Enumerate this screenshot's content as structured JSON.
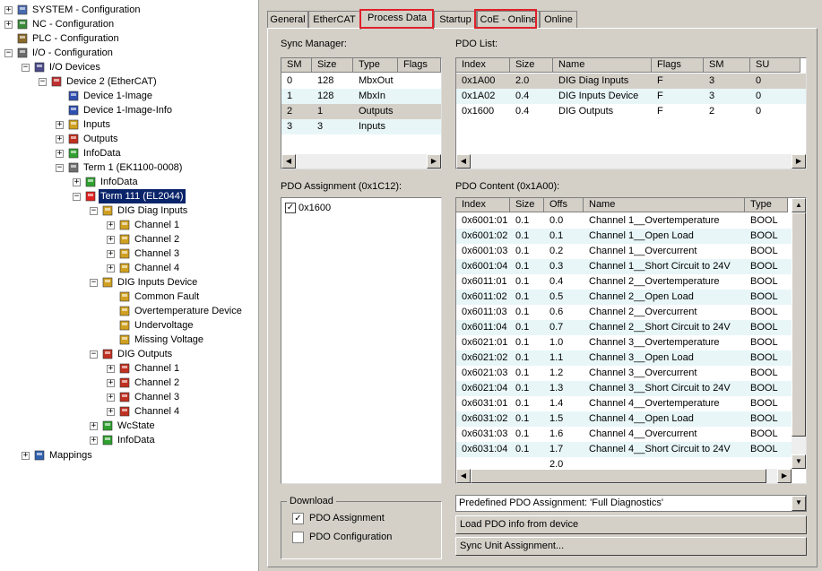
{
  "tree": {
    "items": [
      {
        "label": "SYSTEM - Configuration",
        "icon": "system-config-icon",
        "expander": "+"
      },
      {
        "label": "NC - Configuration",
        "icon": "nc-config-icon",
        "expander": "+"
      },
      {
        "label": "PLC - Configuration",
        "icon": "plc-config-icon",
        "expander": ""
      },
      {
        "label": "I/O - Configuration",
        "icon": "io-config-icon",
        "expander": "-"
      },
      {
        "label": "I/O Devices",
        "icon": "io-devices-icon",
        "expander": "-"
      },
      {
        "label": "Device 2 (EtherCAT)",
        "icon": "ethercat-device-icon",
        "expander": "-"
      },
      {
        "label": "Device 1-Image",
        "icon": "device-image-icon",
        "expander": ""
      },
      {
        "label": "Device 1-Image-Info",
        "icon": "device-image-info-icon",
        "expander": ""
      },
      {
        "label": "Inputs",
        "icon": "inputs-icon",
        "expander": "+"
      },
      {
        "label": "Outputs",
        "icon": "outputs-icon",
        "expander": "+"
      },
      {
        "label": "InfoData",
        "icon": "infodata-icon",
        "expander": "+"
      },
      {
        "label": "Term 1 (EK1100-0008)",
        "icon": "coupler-icon",
        "expander": "-"
      },
      {
        "label": "InfoData",
        "icon": "infodata-icon",
        "expander": "+"
      },
      {
        "label": "Term 111 (EL2044)",
        "icon": "terminal-icon",
        "expander": "-",
        "selected": true
      },
      {
        "label": "DIG Diag Inputs",
        "icon": "inputs-icon",
        "expander": "-"
      },
      {
        "label": "Channel 1",
        "icon": "input-channel-icon",
        "expander": "+"
      },
      {
        "label": "Channel 2",
        "icon": "input-channel-icon",
        "expander": "+"
      },
      {
        "label": "Channel 3",
        "icon": "input-channel-icon",
        "expander": "+"
      },
      {
        "label": "Channel 4",
        "icon": "input-channel-icon",
        "expander": "+"
      },
      {
        "label": "DIG Inputs Device",
        "icon": "inputs-icon",
        "expander": "-"
      },
      {
        "label": "Common Fault",
        "icon": "input-variable-icon",
        "expander": ""
      },
      {
        "label": "Overtemperature Device",
        "icon": "input-variable-icon",
        "expander": ""
      },
      {
        "label": "Undervoltage",
        "icon": "input-variable-icon",
        "expander": ""
      },
      {
        "label": "Missing Voltage",
        "icon": "input-variable-icon",
        "expander": ""
      },
      {
        "label": "DIG Outputs",
        "icon": "outputs-icon",
        "expander": "-"
      },
      {
        "label": "Channel 1",
        "icon": "output-channel-icon",
        "expander": "+"
      },
      {
        "label": "Channel 2",
        "icon": "output-channel-icon",
        "expander": "+"
      },
      {
        "label": "Channel 3",
        "icon": "output-channel-icon",
        "expander": "+"
      },
      {
        "label": "Channel 4",
        "icon": "output-channel-icon",
        "expander": "+"
      },
      {
        "label": "WcState",
        "icon": "wcstate-icon",
        "expander": "+"
      },
      {
        "label": "InfoData",
        "icon": "infodata-icon",
        "expander": "+"
      },
      {
        "label": "Mappings",
        "icon": "mappings-icon",
        "expander": "+"
      }
    ]
  },
  "tabs": [
    "General",
    "EtherCAT",
    "Process Data",
    "Startup",
    "CoE - Online",
    "Online"
  ],
  "active_tab": "Process Data",
  "annotations": {
    "a": "A",
    "b": "B"
  },
  "colors": {
    "selection": "#0a246a",
    "annotation": "#e0202a",
    "alt_row": "#e8f6f8",
    "panel": "#d4d0c8"
  },
  "sync_manager": {
    "title": "Sync Manager:",
    "columns": [
      "SM",
      "Size",
      "Type",
      "Flags"
    ],
    "rows": [
      [
        "0",
        "128",
        "MbxOut",
        ""
      ],
      [
        "1",
        "128",
        "MbxIn",
        ""
      ],
      [
        "2",
        "1",
        "Outputs",
        ""
      ],
      [
        "3",
        "3",
        "Inputs",
        ""
      ]
    ]
  },
  "pdo_list": {
    "title": "PDO List:",
    "columns": [
      "Index",
      "Size",
      "Name",
      "Flags",
      "SM",
      "SU"
    ],
    "rows": [
      [
        "0x1A00",
        "2.0",
        "DIG Diag Inputs",
        "F",
        "3",
        "0"
      ],
      [
        "0x1A02",
        "0.4",
        "DIG Inputs Device",
        "F",
        "3",
        "0"
      ],
      [
        "0x1600",
        "0.4",
        "DIG Outputs",
        "F",
        "2",
        "0"
      ]
    ]
  },
  "pdo_assignment": {
    "title": "PDO Assignment (0x1C12):",
    "items": [
      {
        "label": "0x1600",
        "checked": true
      }
    ]
  },
  "pdo_content": {
    "title": "PDO Content (0x1A00):",
    "columns": [
      "Index",
      "Size",
      "Offs",
      "Name",
      "Type"
    ],
    "rows": [
      [
        "0x6001:01",
        "0.1",
        "0.0",
        "Channel 1__Overtemperature",
        "BOOL"
      ],
      [
        "0x6001:02",
        "0.1",
        "0.1",
        "Channel 1__Open Load",
        "BOOL"
      ],
      [
        "0x6001:03",
        "0.1",
        "0.2",
        "Channel 1__Overcurrent",
        "BOOL"
      ],
      [
        "0x6001:04",
        "0.1",
        "0.3",
        "Channel 1__Short Circuit to 24V",
        "BOOL"
      ],
      [
        "0x6011:01",
        "0.1",
        "0.4",
        "Channel 2__Overtemperature",
        "BOOL"
      ],
      [
        "0x6011:02",
        "0.1",
        "0.5",
        "Channel 2__Open Load",
        "BOOL"
      ],
      [
        "0x6011:03",
        "0.1",
        "0.6",
        "Channel 2__Overcurrent",
        "BOOL"
      ],
      [
        "0x6011:04",
        "0.1",
        "0.7",
        "Channel 2__Short Circuit to 24V",
        "BOOL"
      ],
      [
        "0x6021:01",
        "0.1",
        "1.0",
        "Channel 3__Overtemperature",
        "BOOL"
      ],
      [
        "0x6021:02",
        "0.1",
        "1.1",
        "Channel 3__Open Load",
        "BOOL"
      ],
      [
        "0x6021:03",
        "0.1",
        "1.2",
        "Channel 3__Overcurrent",
        "BOOL"
      ],
      [
        "0x6021:04",
        "0.1",
        "1.3",
        "Channel 3__Short Circuit to 24V",
        "BOOL"
      ],
      [
        "0x6031:01",
        "0.1",
        "1.4",
        "Channel 4__Overtemperature",
        "BOOL"
      ],
      [
        "0x6031:02",
        "0.1",
        "1.5",
        "Channel 4__Open Load",
        "BOOL"
      ],
      [
        "0x6031:03",
        "0.1",
        "1.6",
        "Channel 4__Overcurrent",
        "BOOL"
      ],
      [
        "0x6031:04",
        "0.1",
        "1.7",
        "Channel 4__Short Circuit to 24V",
        "BOOL"
      ],
      [
        "",
        "",
        "2.0",
        "",
        ""
      ]
    ]
  },
  "download": {
    "title": "Download",
    "pdo_assignment": {
      "label": "PDO Assignment",
      "checked": true
    },
    "pdo_configuration": {
      "label": "PDO Configuration",
      "checked": false
    }
  },
  "predefined_combo": "Predefined PDO Assignment: 'Full Diagnostics'",
  "buttons": {
    "load_pdo": "Load PDO info from device",
    "sync_unit": "Sync Unit Assignment..."
  }
}
